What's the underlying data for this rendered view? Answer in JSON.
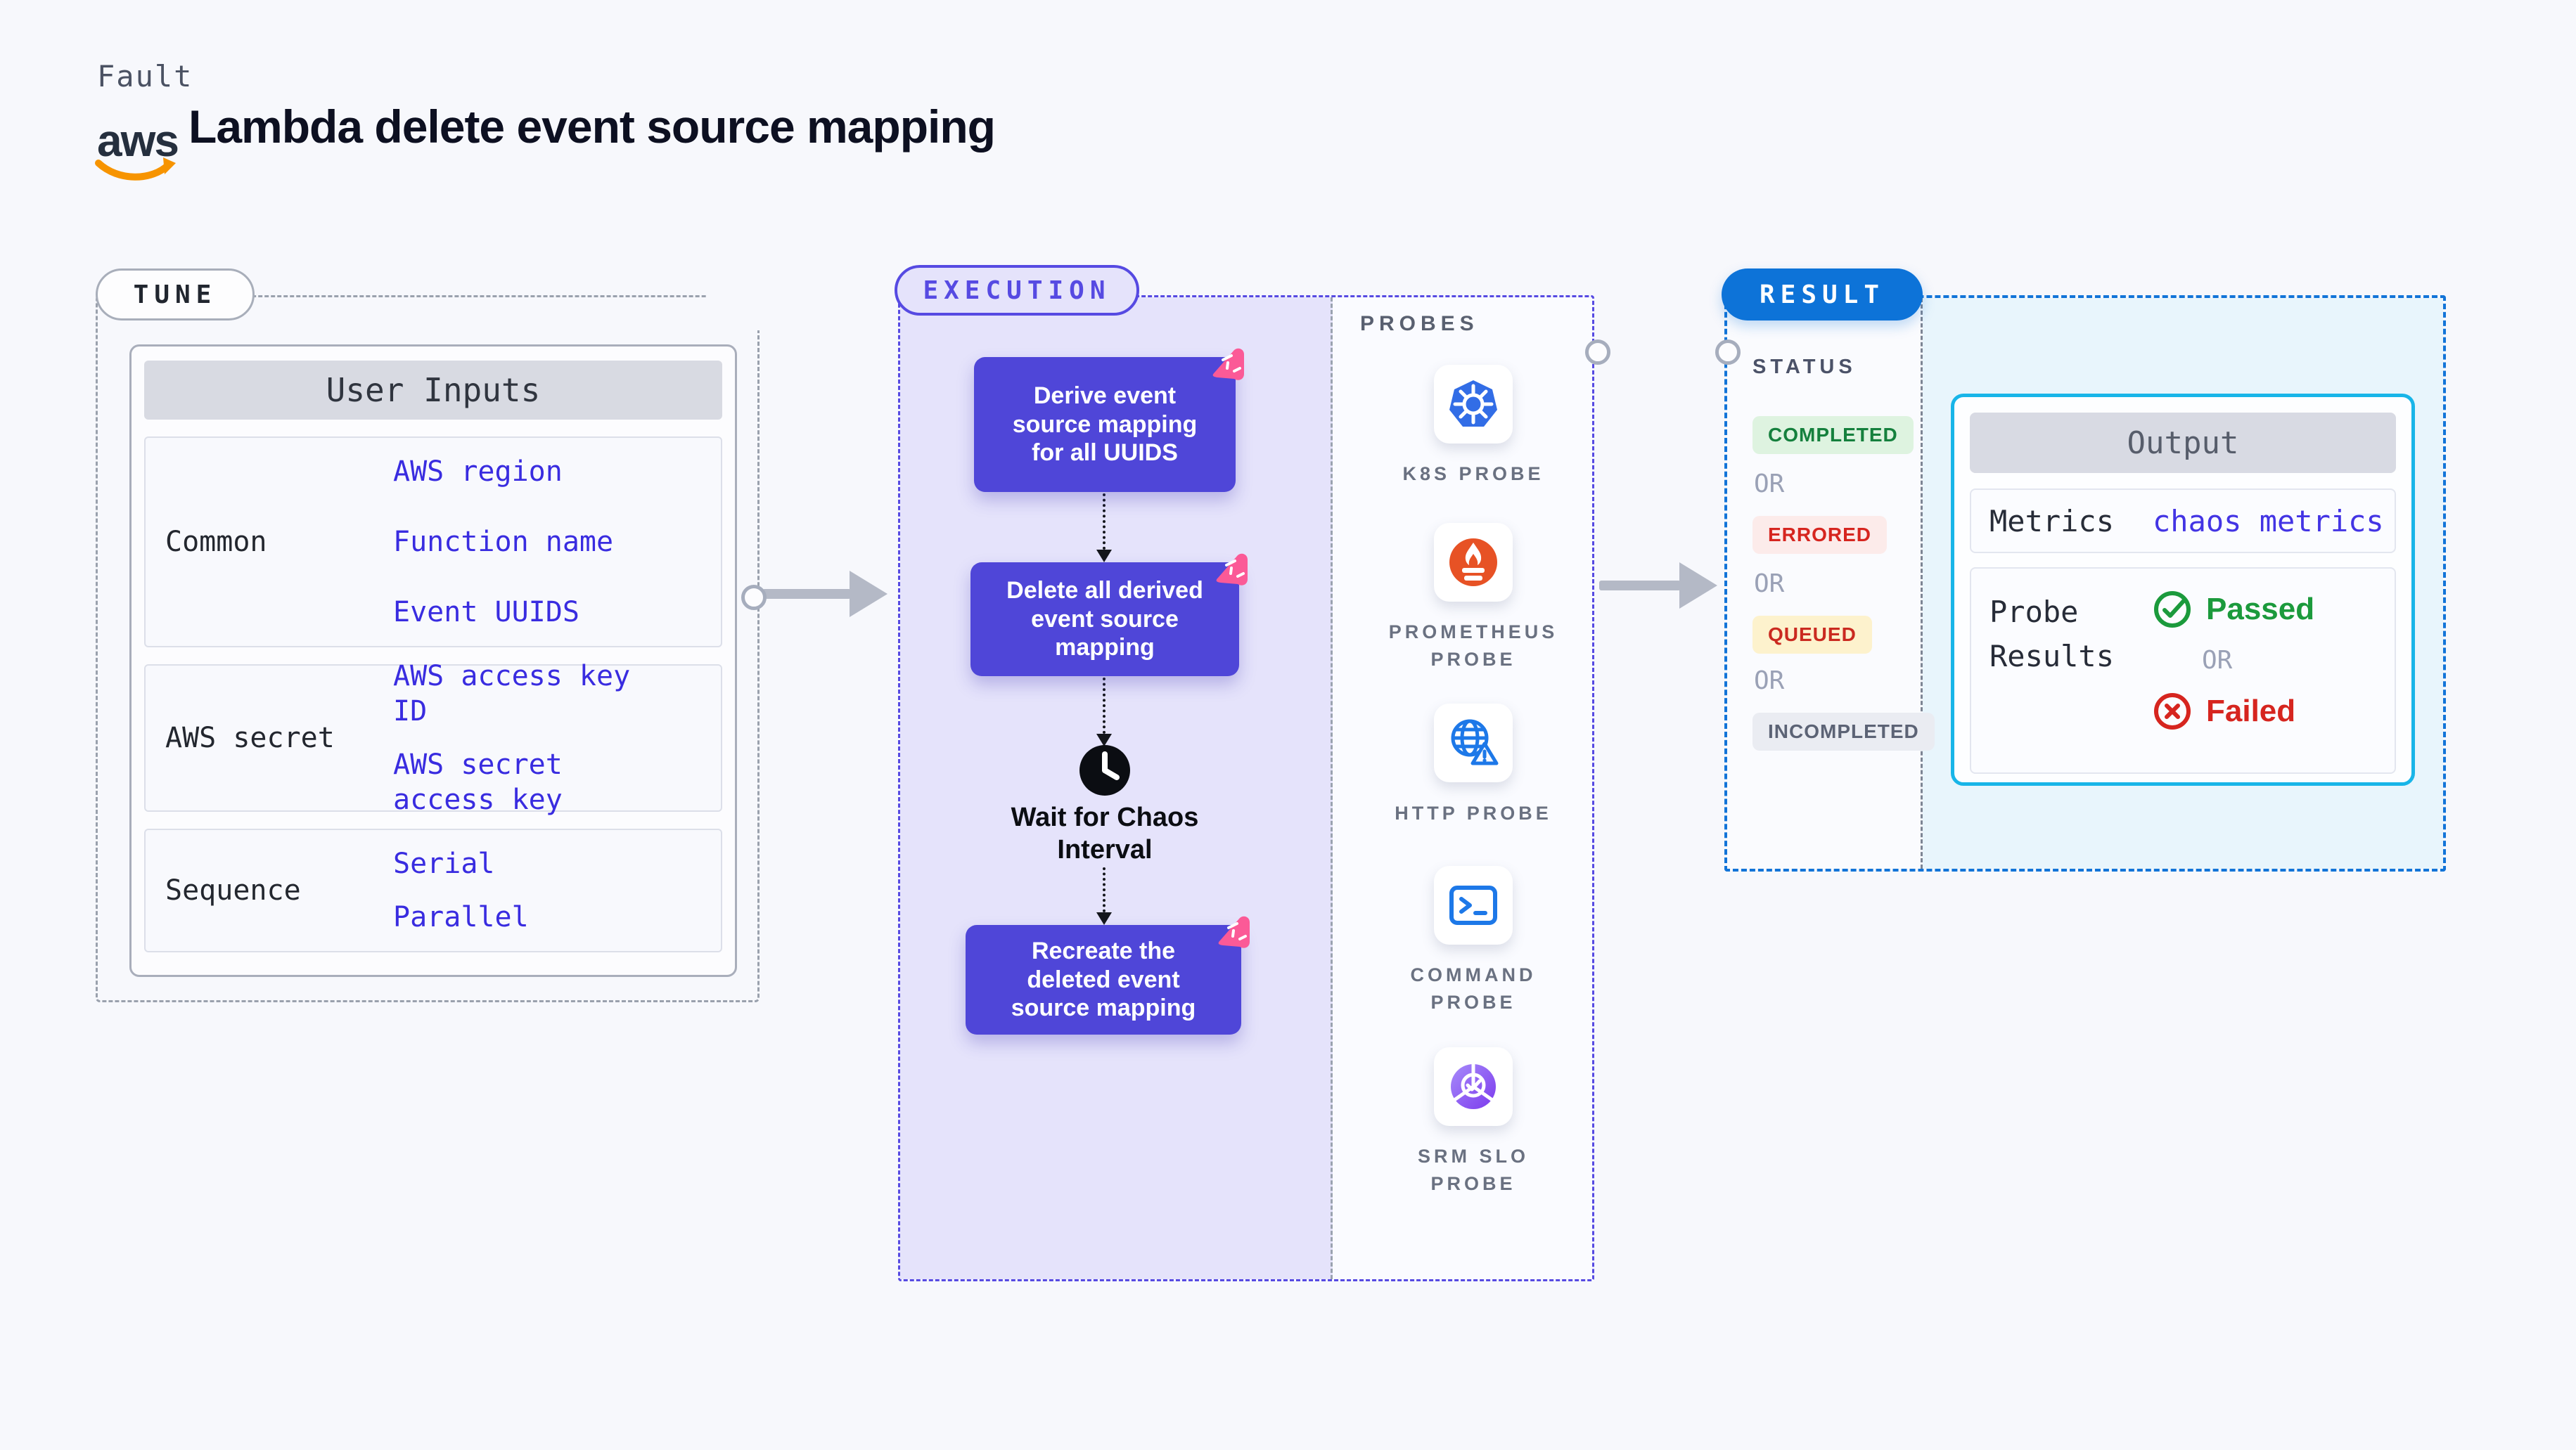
{
  "header": {
    "kicker": "Fault",
    "title": "Lambda delete event source mapping",
    "aws_label": "aws"
  },
  "tune": {
    "pill": "TUNE",
    "table": {
      "header": "User Inputs",
      "rows": [
        {
          "label": "Common",
          "links": [
            "AWS region",
            "Function name",
            "Event UUIDS"
          ]
        },
        {
          "label": "AWS secret",
          "links": [
            "AWS access key ID",
            "AWS secret access key"
          ]
        },
        {
          "label": "Sequence",
          "links": [
            "Serial",
            "Parallel"
          ]
        }
      ]
    }
  },
  "execution": {
    "pill": "EXECUTION",
    "steps": [
      "Derive event source mapping for all UUIDS",
      "Delete all derived event source mapping",
      "Recreate the deleted event source mapping"
    ],
    "wait_label": "Wait for Chaos Interval"
  },
  "probes": {
    "heading": "PROBES",
    "items": [
      {
        "label": "K8S PROBE",
        "icon": "kubernetes-icon"
      },
      {
        "label": "PROMETHEUS PROBE",
        "icon": "prometheus-icon"
      },
      {
        "label": "HTTP PROBE",
        "icon": "http-globe-warning-icon"
      },
      {
        "label": "COMMAND PROBE",
        "icon": "terminal-icon"
      },
      {
        "label": "SRM SLO PROBE",
        "icon": "slo-donut-check-icon"
      }
    ]
  },
  "result": {
    "pill": "RESULT",
    "status_heading": "STATUS",
    "or_label": "OR",
    "statuses": [
      {
        "label": "COMPLETED",
        "fg": "#15803d",
        "bg": "#def3e0"
      },
      {
        "label": "ERRORED",
        "fg": "#d6251f",
        "bg": "#fcebea"
      },
      {
        "label": "QUEUED",
        "fg": "#ca2a20",
        "bg": "#fdf2cd"
      },
      {
        "label": "INCOMPLETED",
        "fg": "#5c6375",
        "bg": "#eaecf2"
      }
    ],
    "output": {
      "header": "Output",
      "metrics_label": "Metrics",
      "metrics_link": "chaos metrics",
      "probe_results_label": "Probe Results",
      "passed": "Passed",
      "failed": "Failed"
    }
  },
  "colors": {
    "page_bg": "#f7f8fc",
    "tune_border": "#9aa1ad",
    "execution_accent": "#564ae2",
    "flow_box": "#4f46d8",
    "execution_bg": "#e5e3fb",
    "result_accent": "#1274d8",
    "result_bg": "#e8f5fc",
    "output_border": "#18b5e8",
    "link_blue": "#392ce0",
    "passed_green": "#1b9a3c",
    "failed_red": "#d6251f",
    "aws_orange": "#f79400",
    "chaos_pink": "#fb5a97",
    "k8s_blue": "#326de6",
    "prometheus_orange": "#e75225"
  }
}
